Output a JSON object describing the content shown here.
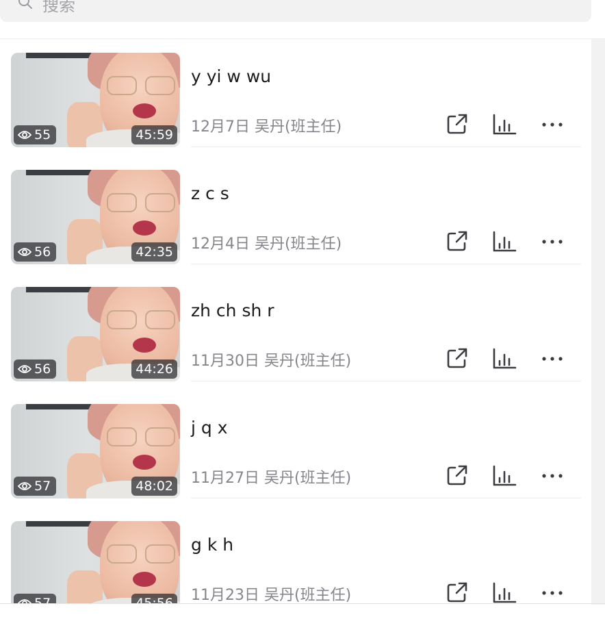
{
  "search": {
    "placeholder": "搜索"
  },
  "videos": [
    {
      "title": "y yi w wu",
      "date": "12月7日",
      "author": "吴丹(班主任)",
      "views": "55",
      "duration": "45:59"
    },
    {
      "title": "z c s",
      "date": "12月4日",
      "author": "吴丹(班主任)",
      "views": "56",
      "duration": "42:35"
    },
    {
      "title": "zh ch sh r",
      "date": "11月30日",
      "author": "吴丹(班主任)",
      "views": "56",
      "duration": "44:26"
    },
    {
      "title": "j q x",
      "date": "11月27日",
      "author": "吴丹(班主任)",
      "views": "57",
      "duration": "48:02"
    },
    {
      "title": "g k h",
      "date": "11月23日",
      "author": "吴丹(班主任)",
      "views": "57",
      "duration": "45:56"
    }
  ],
  "icons": {
    "search": "search-icon",
    "views": "eye-icon",
    "share": "share-icon",
    "stats": "bar-chart-icon",
    "more": "more-icon"
  },
  "colors": {
    "text_primary": "#1b1b1f",
    "text_secondary": "#85858b",
    "icon": "#3a3a40",
    "search_bg": "#f2f2f3"
  }
}
